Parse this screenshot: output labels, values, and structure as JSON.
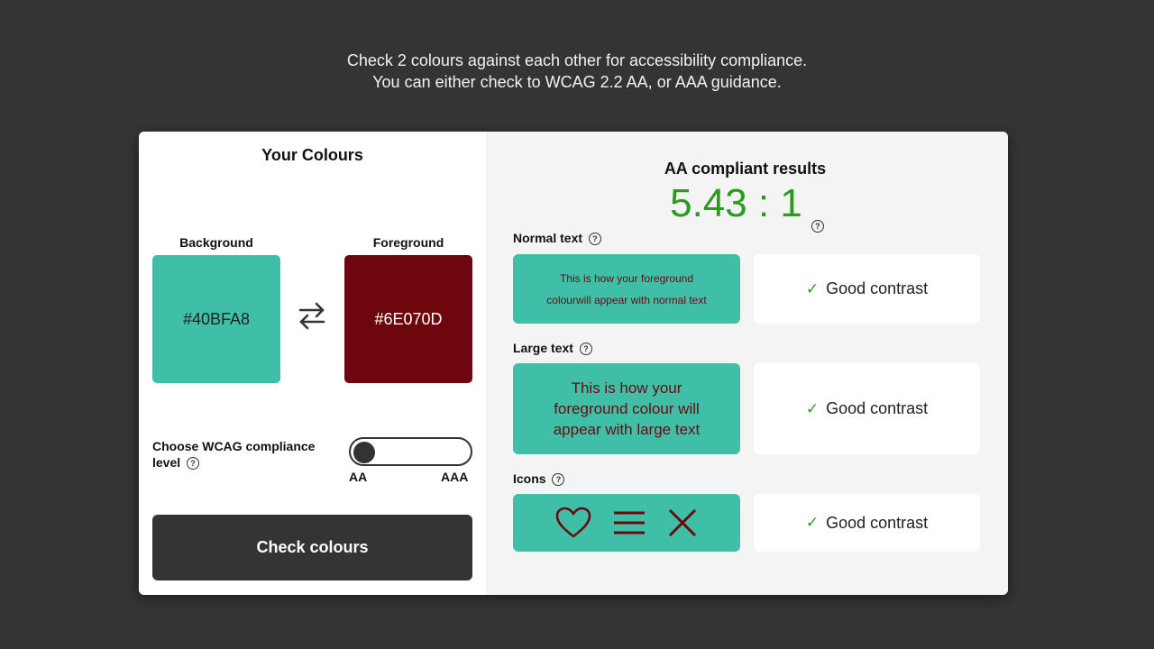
{
  "intro": {
    "line1": "Check 2 colours against each other for accessibility compliance.",
    "line2": "You can either check to WCAG 2.2 AA, or AAA guidance."
  },
  "left_panel": {
    "title": "Your Colours",
    "background": {
      "label": "Background",
      "hex": "#40BFA8",
      "color": "#40BFA8"
    },
    "foreground": {
      "label": "Foreground",
      "hex": "#6E070D",
      "color": "#6E070D"
    },
    "swap_icon": "swap-arrows-icon",
    "wcag": {
      "label": "Choose WCAG compliance level",
      "help": "?",
      "options": [
        "AA",
        "AAA"
      ],
      "selected": "AA"
    },
    "check_button": "Check colours"
  },
  "right_panel": {
    "title": "AA compliant results",
    "ratio": "5.43 : 1",
    "ratio_help": "?",
    "ratio_color": "#2b9a1e",
    "sections": [
      {
        "label": "Normal text",
        "help": "?",
        "preview_line1": "This is how your foreground",
        "preview_line2": "colourwill appear with normal text",
        "result": "Good contrast",
        "result_icon": "checkmark-icon"
      },
      {
        "label": "Large text",
        "help": "?",
        "preview": "This is how your foreground colour will appear with large text",
        "result": "Good contrast",
        "result_icon": "checkmark-icon"
      },
      {
        "label": "Icons",
        "help": "?",
        "icons": [
          "heart-icon",
          "menu-icon",
          "close-icon"
        ],
        "result": "Good contrast",
        "result_icon": "checkmark-icon"
      }
    ],
    "tick_glyph": "✓"
  }
}
